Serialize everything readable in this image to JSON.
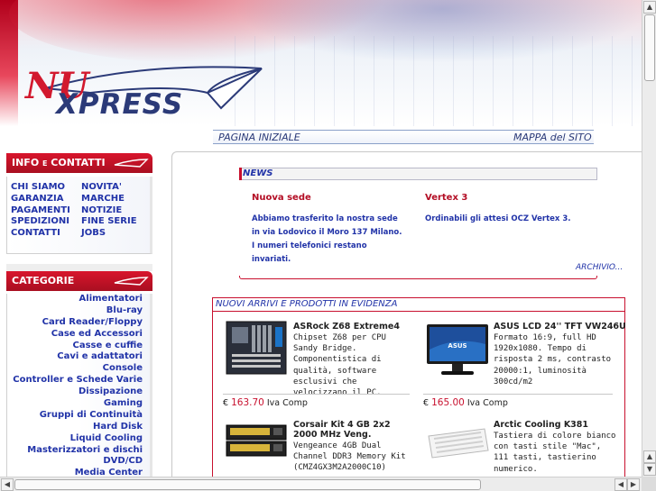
{
  "header": {
    "logo_top": "NU",
    "logo_bottom": "XPRESS",
    "nav_home": "PAGINA INIZIALE",
    "nav_sitemap": "MAPPA del SITO"
  },
  "sidebar": {
    "info_title": "INFO E CONTATTI",
    "info_links": [
      "CHI SIAMO",
      "NOVITA'",
      "GARANZIA",
      "MARCHE",
      "PAGAMENTI",
      "NOTIZIE",
      "SPEDIZIONI",
      "FINE SERIE",
      "CONTATTI",
      "JOBS"
    ],
    "categories_title": "CATEGORIE",
    "categories": [
      "Alimentatori",
      "Blu-ray",
      "Card Reader/Floppy",
      "Case ed Accessori",
      "Casse e cuffie",
      "Cavi e adattatori",
      "Console",
      "Controller e Schede Varie",
      "Dissipazione",
      "Gaming",
      "Gruppi di Continuità",
      "Hard Disk",
      "Liquid Cooling",
      "Masterizzatori e dischi",
      "DVD/CD",
      "Media Center"
    ]
  },
  "news": {
    "heading": "NEWS",
    "items": [
      {
        "title": "Nuova sede",
        "text": "Abbiamo trasferito la nostra sede in via Lodovico il Moro 137 Milano. I numeri telefonici restano invariati."
      },
      {
        "title": "Vertex 3",
        "text": "Ordinabili gli attesi OCZ Vertex 3."
      }
    ],
    "archive_link": "ARCHIVIO..."
  },
  "featured": {
    "heading": "NUOVI ARRIVI E PRODOTTI IN EVIDENZA",
    "products": [
      {
        "title": "ASRock Z68 Extreme4",
        "desc": "Chipset Z68 per CPU Sandy Bridge. Componentistica di qualità, software esclusivi che velocizzano il PC.",
        "currency": "€",
        "price": "163.70",
        "tax": "Iva Comp"
      },
      {
        "title": "ASUS LCD 24'' TFT VW246U",
        "desc": "Formato 16:9, full HD 1920x1080. Tempo di risposta 2 ms, contrasto 20000:1, luminosità 300cd/m2",
        "currency": "€",
        "price": "165.00",
        "tax": "Iva Comp"
      },
      {
        "title": "Corsair Kit 4 GB 2x2 2000 MHz Veng.",
        "desc": "Vengeance 4GB Dual Channel DDR3 Memory Kit (CMZ4GX3M2A2000C10)"
      },
      {
        "title": "Arctic Cooling K381",
        "desc": "Tastiera di colore bianco con tasti stile \"Mac\", 111 tasti, tastierino numerico."
      }
    ]
  },
  "colors": {
    "brand_red": "#c8102e",
    "link_blue": "#2133a8",
    "logo_blue": "#2b3a78"
  }
}
